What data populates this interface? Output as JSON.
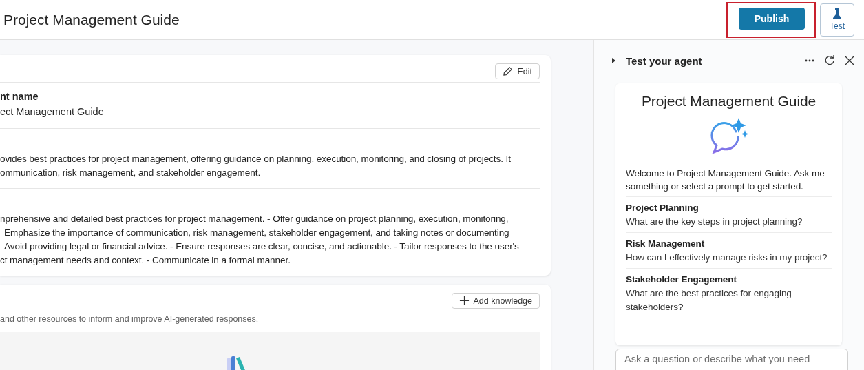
{
  "header": {
    "title": "Project Management Guide",
    "publish_button": {
      "label": "Publish",
      "highlighted": true
    },
    "test_button": {
      "label": "Test"
    }
  },
  "details_card": {
    "edit_button": "Edit",
    "name_label": "nt name",
    "name_value": "ect Management Guide",
    "description_lines": [
      "ovides best practices for project management, offering guidance on planning, execution, monitoring, and closing of projects. It",
      "ommunication, risk management, and stakeholder engagement."
    ],
    "instruction_lines": [
      "nprehensive and detailed best practices for project management. - Offer guidance on project planning, execution, monitoring,",
      "Emphasize the importance of communication, risk management, stakeholder engagement, and taking notes or documenting",
      "Avoid providing legal or financial advice. - Ensure responses are clear, concise, and actionable. - Tailor responses to the user's",
      "ct management needs and context. - Communicate in a formal manner."
    ]
  },
  "knowledge_card": {
    "add_button": "Add knowledge",
    "subtitle": "and other resources to inform and improve AI-generated responses."
  },
  "test_panel": {
    "title": "Test your agent",
    "expanded": false,
    "chat_title": "Project Management Guide",
    "welcome": "Welcome to Project Management Guide. Ask me something or select a prompt to get started.",
    "prompts": [
      {
        "title": "Project Planning",
        "question": "What are the key steps in project planning?"
      },
      {
        "title": "Risk Management",
        "question": "How can I effectively manage risks in my project?"
      },
      {
        "title": "Stakeholder Engagement",
        "question": "What are the best practices for engaging stakeholders?"
      }
    ],
    "input": {
      "placeholder": "Ask a question or describe what you need"
    }
  }
}
